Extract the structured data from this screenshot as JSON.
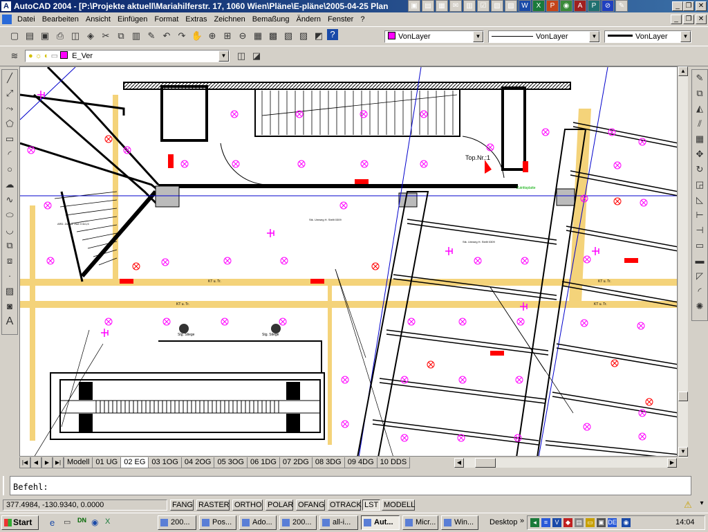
{
  "window": {
    "title": "AutoCAD 2004 - [P:\\Projekte aktuell\\Mariahilferstr. 17, 1060 Wien\\Pläne\\E-pläne\\2005-04-25 Plan",
    "app_icon": "A"
  },
  "menu": [
    "Datei",
    "Bearbeiten",
    "Ansicht",
    "Einfügen",
    "Format",
    "Extras",
    "Zeichnen",
    "Bemaßung",
    "Ändern",
    "Fenster",
    "?"
  ],
  "toolbar": {
    "color_combo": "VonLayer",
    "linetype_combo": "VonLayer",
    "lineweight_combo": "VonLayer",
    "layer_combo": "E_Ver",
    "colors": {
      "magenta": "#ff00ff",
      "red": "#ff0000",
      "yellow_conduit": "#f4d37a",
      "blue_axis": "#0000cc"
    }
  },
  "drawing": {
    "labels": {
      "top_nr": "Top.Nr.:1",
      "kt": "KT u. Tr.",
      "stg_st1": "Stg. Stiege",
      "stg_st2": "Stg. Stiege",
      "label_cable": "Stk. Umweg H. Stellt 0309",
      "label_bus": "ARD. Zusatz -Not II 4x1,5",
      "label_green": "Zutrittsplatte"
    }
  },
  "tabs": [
    "Modell",
    "01 UG",
    "02 EG",
    "03 1OG",
    "04 2OG",
    "05 3OG",
    "06 1DG",
    "07 2DG",
    "08 3DG",
    "09 4DG",
    "10 DDS"
  ],
  "active_tab": "02 EG",
  "command": {
    "prompt": "Befehl:"
  },
  "status": {
    "coords": "377.4984, -130.9340, 0.0000",
    "toggles": [
      "FANG",
      "RASTER",
      "ORTHO",
      "POLAR",
      "OFANG",
      "OTRACK",
      "LST",
      "MODELL"
    ],
    "active": [
      "LST"
    ]
  },
  "taskbar": {
    "start": "Start",
    "tasks": [
      "200...",
      "Pos...",
      "Ado...",
      "200...",
      "all-i...",
      "Aut...",
      "Micr...",
      "Win..."
    ],
    "active_task": "Aut...",
    "desktop": "Desktop",
    "language": "DE",
    "clock": "14:04"
  }
}
